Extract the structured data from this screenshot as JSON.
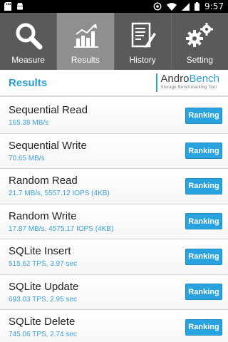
{
  "status_bar": {
    "time": "9:57",
    "left_icons": [
      "sd-card-icon",
      "android-icon"
    ],
    "right_icons": [
      "alarm-icon",
      "wifi-icon",
      "signal-icon",
      "battery-icon"
    ]
  },
  "tabs": [
    {
      "label": "Measure",
      "icon": "magnifier-icon",
      "active": false
    },
    {
      "label": "Results",
      "icon": "bar-chart-icon",
      "active": true
    },
    {
      "label": "History",
      "icon": "notepad-icon",
      "active": false
    },
    {
      "label": "Setting",
      "icon": "gears-icon",
      "active": false
    }
  ],
  "header": {
    "title": "Results",
    "logo_andro": "Andro",
    "logo_bench": "Bench",
    "logo_sub": "Storage Benchmarking Tool"
  },
  "results": [
    {
      "title": "Sequential Read",
      "value": "165.38 MB/s",
      "button": "Ranking"
    },
    {
      "title": "Sequential Write",
      "value": "70.65 MB/s",
      "button": "Ranking"
    },
    {
      "title": "Random Read",
      "value": "21.7 MB/s, 5557.12 IOPS (4KB)",
      "button": "Ranking"
    },
    {
      "title": "Random Write",
      "value": "17.87 MB/s, 4575.17 IOPS (4KB)",
      "button": "Ranking"
    },
    {
      "title": "SQLite Insert",
      "value": "515.62 TPS, 3.97 sec",
      "button": "Ranking"
    },
    {
      "title": "SQLite Update",
      "value": "693.03 TPS, 2.95 sec",
      "button": "Ranking"
    },
    {
      "title": "SQLite Delete",
      "value": "745.06 TPS, 2.74 sec",
      "button": "Ranking"
    }
  ],
  "colors": {
    "accent": "#2a9fd6",
    "tab_bg": "#5a5a5a",
    "tab_active_bg": "#8f8f8f",
    "button_bg": "#29a3e0"
  }
}
